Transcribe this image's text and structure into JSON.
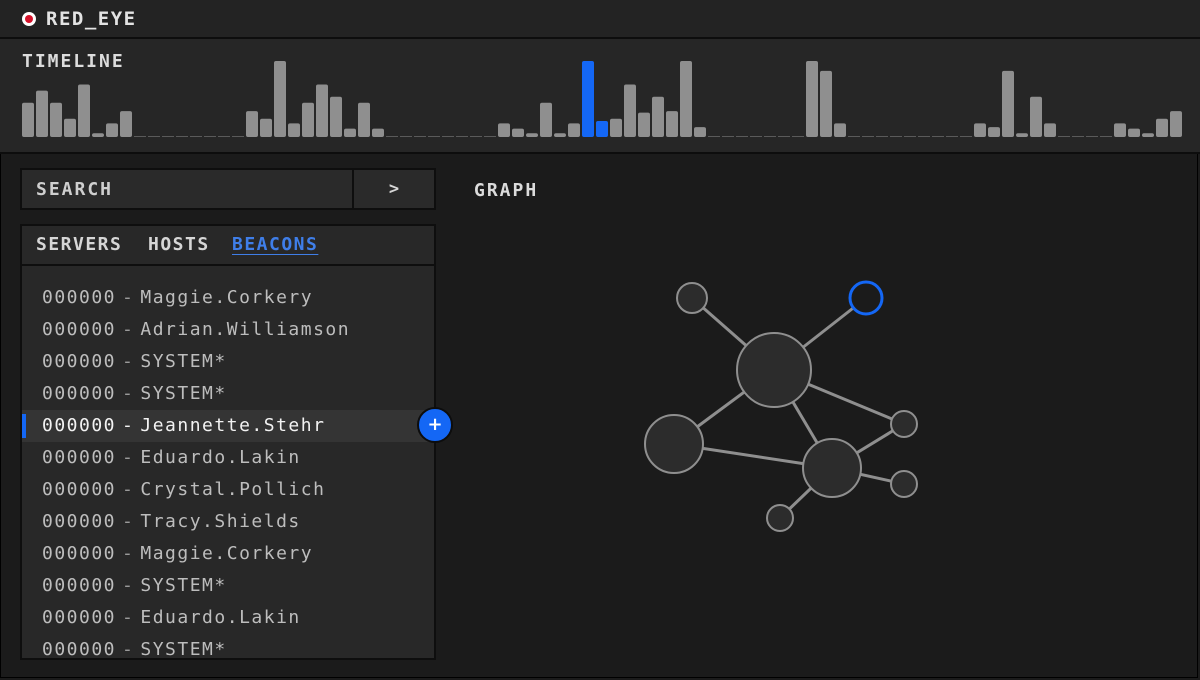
{
  "app": {
    "title": "RED_EYE",
    "accent": "#1467f5",
    "record_color": "#d4122a"
  },
  "timeline": {
    "label": "TIMELINE",
    "highlight_color": "#1467f5",
    "bar_color": "#8f8f8f",
    "bars": [
      {
        "v": 0.45
      },
      {
        "v": 0.61
      },
      {
        "v": 0.45
      },
      {
        "v": 0.24
      },
      {
        "v": 0.69
      },
      {
        "v": 0.05
      },
      {
        "v": 0.18
      },
      {
        "v": 0.34
      },
      {
        "v": 0.0
      },
      {
        "v": 0.0
      },
      {
        "v": 0.0
      },
      {
        "v": 0.0
      },
      {
        "v": 0.0
      },
      {
        "v": 0.0
      },
      {
        "v": 0.0
      },
      {
        "v": 0.0
      },
      {
        "v": 0.34
      },
      {
        "v": 0.24
      },
      {
        "v": 1.0
      },
      {
        "v": 0.18
      },
      {
        "v": 0.45
      },
      {
        "v": 0.69
      },
      {
        "v": 0.53
      },
      {
        "v": 0.11
      },
      {
        "v": 0.45
      },
      {
        "v": 0.11
      },
      {
        "v": 0.0
      },
      {
        "v": 0.0
      },
      {
        "v": 0.0
      },
      {
        "v": 0.0
      },
      {
        "v": 0.0
      },
      {
        "v": 0.0
      },
      {
        "v": 0.0
      },
      {
        "v": 0.0
      },
      {
        "v": 0.18
      },
      {
        "v": 0.11
      },
      {
        "v": 0.05
      },
      {
        "v": 0.45
      },
      {
        "v": 0.05
      },
      {
        "v": 0.18
      },
      {
        "v": 1.0,
        "h": true
      },
      {
        "v": 0.21,
        "h": true
      },
      {
        "v": 0.24
      },
      {
        "v": 0.69
      },
      {
        "v": 0.32
      },
      {
        "v": 0.53
      },
      {
        "v": 0.34
      },
      {
        "v": 1.0
      },
      {
        "v": 0.13
      },
      {
        "v": 0.0
      },
      {
        "v": 0.0
      },
      {
        "v": 0.0
      },
      {
        "v": 0.0
      },
      {
        "v": 0.0
      },
      {
        "v": 0.0
      },
      {
        "v": 0.0
      },
      {
        "v": 1.0
      },
      {
        "v": 0.87
      },
      {
        "v": 0.18
      },
      {
        "v": 0.0
      },
      {
        "v": 0.0
      },
      {
        "v": 0.0
      },
      {
        "v": 0.0
      },
      {
        "v": 0.0
      },
      {
        "v": 0.0
      },
      {
        "v": 0.0
      },
      {
        "v": 0.0
      },
      {
        "v": 0.0
      },
      {
        "v": 0.18
      },
      {
        "v": 0.13
      },
      {
        "v": 0.87
      },
      {
        "v": 0.05
      },
      {
        "v": 0.53
      },
      {
        "v": 0.18
      },
      {
        "v": 0.0
      },
      {
        "v": 0.0
      },
      {
        "v": 0.0
      },
      {
        "v": 0.0
      },
      {
        "v": 0.18
      },
      {
        "v": 0.11
      },
      {
        "v": 0.05
      },
      {
        "v": 0.24
      },
      {
        "v": 0.34
      }
    ]
  },
  "search": {
    "placeholder": "SEARCH",
    "button_label": ">"
  },
  "tabs": [
    {
      "label": "SERVERS",
      "active": false
    },
    {
      "label": "HOSTS",
      "active": false
    },
    {
      "label": "BEACONS",
      "active": true
    }
  ],
  "list": {
    "selected_index": 4,
    "add_label": "+",
    "items": [
      {
        "id": "000000",
        "sep": "-",
        "name": "Maggie.Corkery"
      },
      {
        "id": "000000",
        "sep": "-",
        "name": "Adrian.Williamson"
      },
      {
        "id": "000000",
        "sep": "-",
        "name": "SYSTEM*"
      },
      {
        "id": "000000",
        "sep": "-",
        "name": "SYSTEM*"
      },
      {
        "id": "000000",
        "sep": "-",
        "name": "Jeannette.Stehr"
      },
      {
        "id": "000000",
        "sep": "-",
        "name": "Eduardo.Lakin"
      },
      {
        "id": "000000",
        "sep": "-",
        "name": "Crystal.Pollich"
      },
      {
        "id": "000000",
        "sep": "-",
        "name": "Tracy.Shields"
      },
      {
        "id": "000000",
        "sep": "-",
        "name": "Maggie.Corkery"
      },
      {
        "id": "000000",
        "sep": "-",
        "name": "SYSTEM*"
      },
      {
        "id": "000000",
        "sep": "-",
        "name": "Eduardo.Lakin"
      },
      {
        "id": "000000",
        "sep": "-",
        "name": "SYSTEM*"
      }
    ]
  },
  "graph": {
    "title": "GRAPH",
    "node_fill": "#2c2c2c",
    "node_stroke": "#8f8f8f",
    "edge_color": "#8f8f8f",
    "selected_stroke": "#1467f5"
  }
}
